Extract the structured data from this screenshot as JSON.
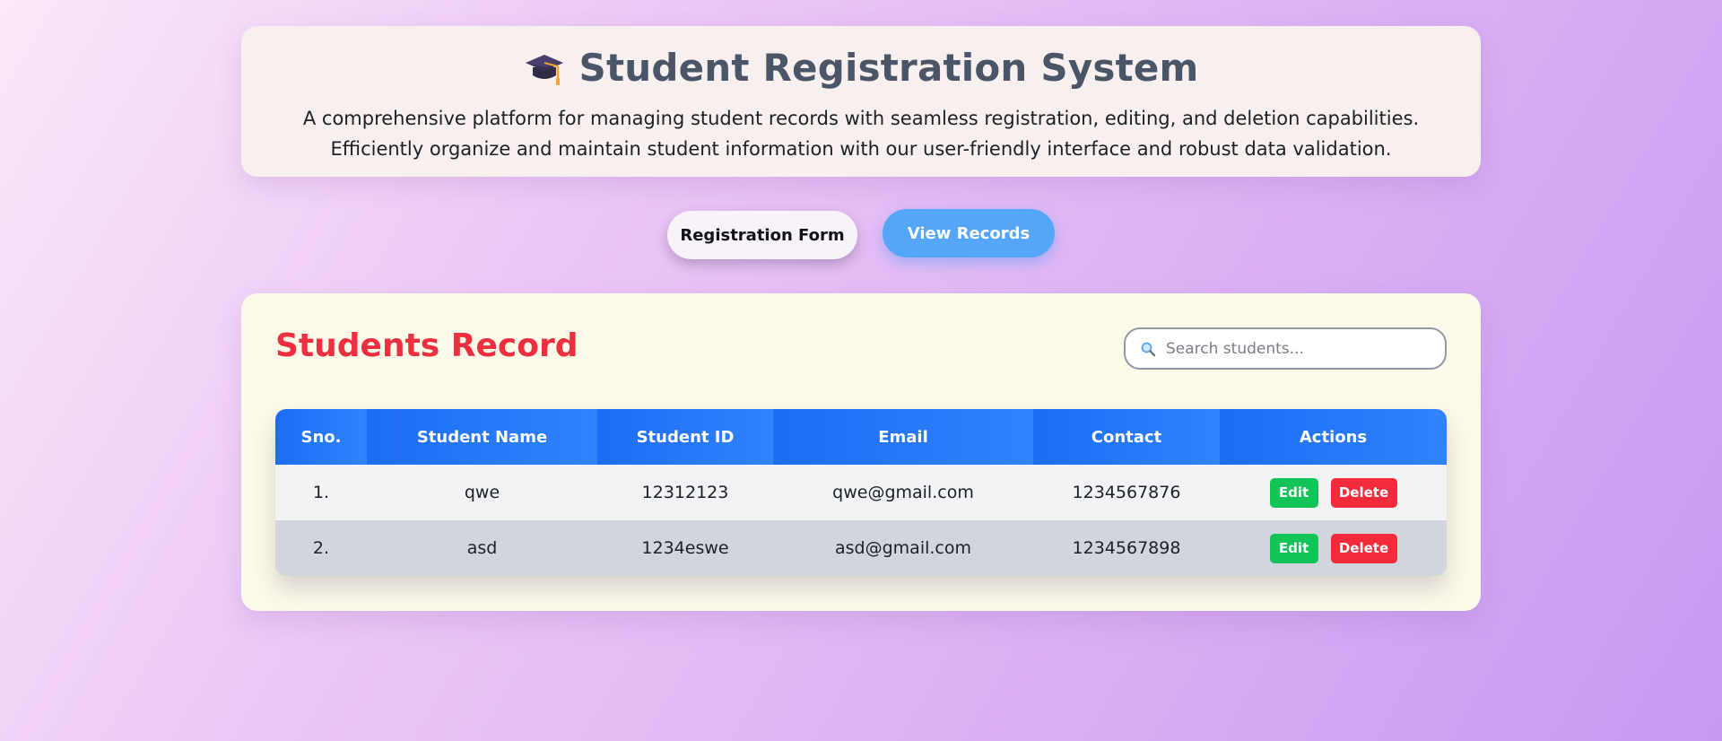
{
  "header": {
    "icon": "graduation-cap-icon",
    "title": "Student Registration System",
    "description_line_1": "A comprehensive platform for managing student records with seamless registration, editing, and deletion capabilities.",
    "description_line_2": "Efficiently organize and maintain student information with our user-friendly interface and robust data validation."
  },
  "nav": {
    "registration_label": "Registration Form",
    "view_records_label": "View Records"
  },
  "records": {
    "title": "Students Record",
    "search": {
      "placeholder": "Search students...",
      "value": ""
    },
    "columns": [
      "Sno.",
      "Student Name",
      "Student ID",
      "Email",
      "Contact",
      "Actions"
    ],
    "rows": [
      {
        "sno": "1.",
        "name": "qwe",
        "student_id": "12312123",
        "email": "qwe@gmail.com",
        "contact": "1234567876",
        "edit_label": "Edit",
        "delete_label": "Delete"
      },
      {
        "sno": "2.",
        "name": "asd",
        "student_id": "1234eswe",
        "email": "asd@gmail.com",
        "contact": "1234567898",
        "edit_label": "Edit",
        "delete_label": "Delete"
      }
    ]
  },
  "colors": {
    "title_text": "#4b5568",
    "records_title": "#ee2f3f",
    "table_header": "#1d6cf5",
    "view_records_button": "#55a6f8",
    "edit_button": "#12c357",
    "delete_button": "#f12a3c"
  }
}
